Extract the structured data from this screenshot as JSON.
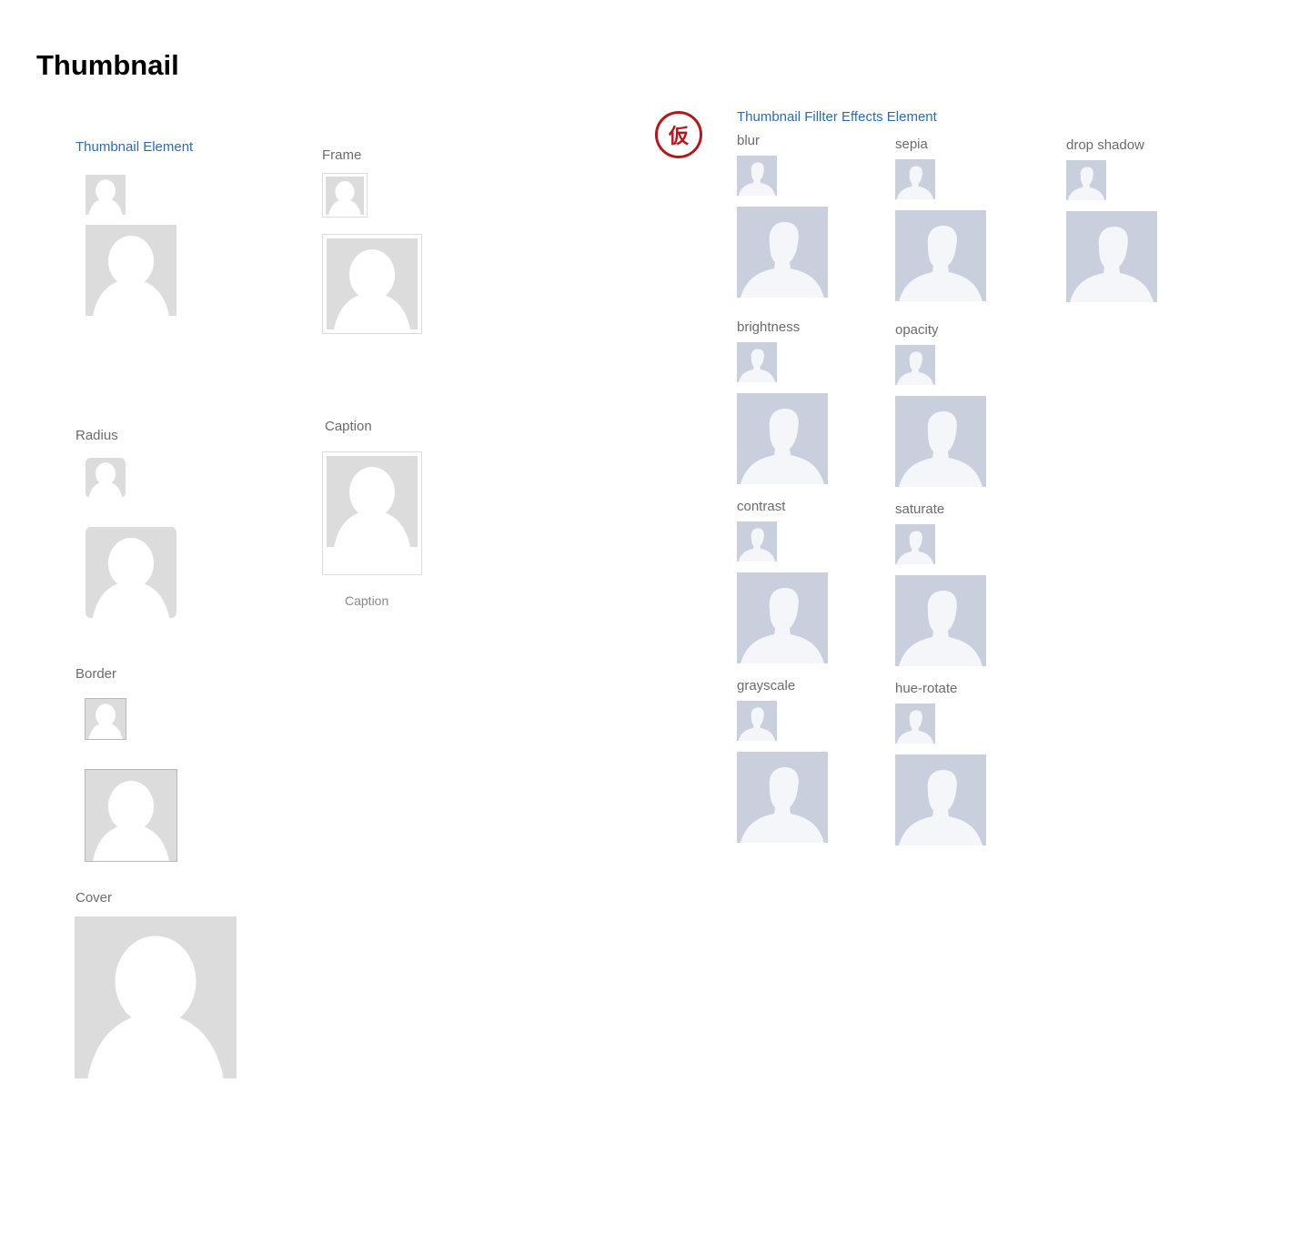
{
  "page": {
    "title": "Thumbnail"
  },
  "thumbnail_element": {
    "title": "Thumbnail Element",
    "frame_label": "Frame",
    "radius_label": "Radius",
    "caption_label": "Caption",
    "caption_text": "Caption",
    "border_label": "Border",
    "cover_label": "Cover"
  },
  "filter_effects": {
    "stamp": "仮",
    "title": "Thumbnail Fillter Effects Element",
    "labels": {
      "blur": "blur",
      "sepia": "sepia",
      "drop_shadow": "drop shadow",
      "brightness": "brightness",
      "opacity": "opacity",
      "contrast": "contrast",
      "saturate": "saturate",
      "grayscale": "grayscale",
      "hue_rotate": "hue-rotate"
    }
  },
  "icons": {
    "placeholder_gray": "avatar-placeholder-icon",
    "placeholder_blue": "avatar-silhouette-icon"
  },
  "colors": {
    "link_blue": "#2b6cb0",
    "stamp_red": "#b0191e",
    "placeholder_gray_bg": "#dcdcdc",
    "placeholder_blue_bg": "#c9cfdc",
    "placeholder_blue_fg": "#f4f6fa"
  }
}
